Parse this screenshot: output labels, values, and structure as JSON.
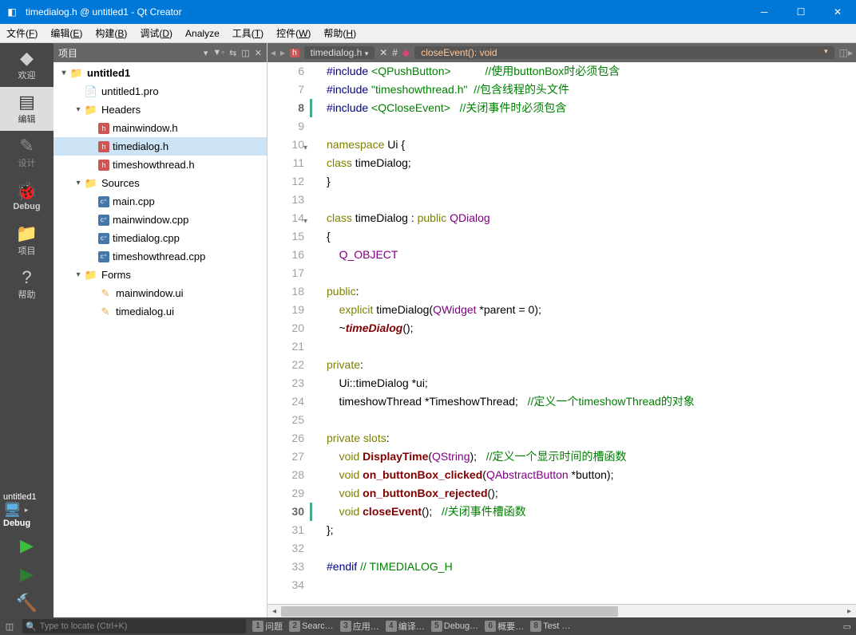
{
  "window": {
    "title": "timedialog.h @ untitled1 - Qt Creator"
  },
  "menu": {
    "items": [
      "文件(F)",
      "编辑(E)",
      "构建(B)",
      "调试(D)",
      "Analyze",
      "工具(T)",
      "控件(W)",
      "帮助(H)"
    ],
    "uline": [
      "F",
      "E",
      "B",
      "D",
      "",
      "T",
      "W",
      "H"
    ]
  },
  "modes": {
    "items": [
      {
        "label": "欢迎",
        "icon": "◆",
        "color": "green"
      },
      {
        "label": "编辑",
        "icon": "▤",
        "active": true
      },
      {
        "label": "设计",
        "icon": "✎",
        "dim": true
      },
      {
        "label": "Debug",
        "icon": "🐞",
        "bold": true
      },
      {
        "label": "项目",
        "icon": "📁"
      },
      {
        "label": "帮助",
        "icon": "?"
      }
    ]
  },
  "kit": {
    "project": "untitled1",
    "build": "Debug"
  },
  "runbuttons": [
    {
      "name": "run",
      "glyph": "▶",
      "color": "green"
    },
    {
      "name": "debug-run",
      "glyph": "▶",
      "color": "darkgreen"
    },
    {
      "name": "build",
      "glyph": "🔨",
      "color": "#c87c3a"
    }
  ],
  "sidepanel": {
    "label": "项目"
  },
  "tree": [
    {
      "d": 0,
      "tw": "▾",
      "fi": "📁",
      "cls": "orange",
      "txt": "untitled1",
      "bold": true
    },
    {
      "d": 1,
      "tw": "",
      "fi": "📄",
      "cls": "",
      "txt": "untitled1.pro"
    },
    {
      "d": 1,
      "tw": "▾",
      "fi": "📁",
      "cls": "orange",
      "txt": "Headers"
    },
    {
      "d": 2,
      "tw": "",
      "fi": "h",
      "cls": "hdr",
      "txt": "mainwindow.h"
    },
    {
      "d": 2,
      "tw": "",
      "fi": "h",
      "cls": "hdr",
      "txt": "timedialog.h",
      "sel": true
    },
    {
      "d": 2,
      "tw": "",
      "fi": "h",
      "cls": "hdr",
      "txt": "timeshowthread.h"
    },
    {
      "d": 1,
      "tw": "▾",
      "fi": "📁",
      "cls": "orange",
      "txt": "Sources"
    },
    {
      "d": 2,
      "tw": "",
      "fi": "c⁺",
      "cls": "src",
      "txt": "main.cpp"
    },
    {
      "d": 2,
      "tw": "",
      "fi": "c⁺",
      "cls": "src",
      "txt": "mainwindow.cpp"
    },
    {
      "d": 2,
      "tw": "",
      "fi": "c⁺",
      "cls": "src",
      "txt": "timedialog.cpp"
    },
    {
      "d": 2,
      "tw": "",
      "fi": "c⁺",
      "cls": "src",
      "txt": "timeshowthread.cpp"
    },
    {
      "d": 1,
      "tw": "▾",
      "fi": "📁",
      "cls": "orange",
      "txt": "Forms"
    },
    {
      "d": 2,
      "tw": "",
      "fi": "✎",
      "cls": "frm",
      "txt": "mainwindow.ui"
    },
    {
      "d": 2,
      "tw": "",
      "fi": "✎",
      "cls": "frm",
      "txt": "timedialog.ui"
    }
  ],
  "edbar": {
    "file": "timedialog.h",
    "hash": "#",
    "sym": "closeEvent(): void"
  },
  "code": {
    "start": 6,
    "current": 30,
    "folds": [
      10,
      14
    ],
    "currentExtra": 8,
    "lines": [
      [
        [
          "pp",
          "#include "
        ],
        [
          "inc",
          "<QPushButton>"
        ],
        [
          "",
          "           "
        ],
        [
          "cm",
          "//使用buttonBox时必须包含"
        ]
      ],
      [
        [
          "pp",
          "#include "
        ],
        [
          "inc",
          "\"timeshowthread.h\""
        ],
        [
          "",
          "  "
        ],
        [
          "cm",
          "//包含线程的头文件"
        ]
      ],
      [
        [
          "pp",
          "#include "
        ],
        [
          "inc",
          "<QCloseEvent>"
        ],
        [
          "",
          "   "
        ],
        [
          "cm",
          "//关闭事件时必须包含"
        ]
      ],
      [],
      [
        [
          "kw",
          "namespace"
        ],
        [
          "",
          " Ui {"
        ]
      ],
      [
        [
          "kw",
          "class"
        ],
        [
          "",
          " timeDialog;"
        ]
      ],
      [
        [
          "",
          "}"
        ]
      ],
      [],
      [
        [
          "kw",
          "class"
        ],
        [
          "",
          " timeDialog : "
        ],
        [
          "kw",
          "public"
        ],
        [
          "",
          " "
        ],
        [
          "ty",
          "QDialog"
        ]
      ],
      [
        [
          "",
          "{"
        ]
      ],
      [
        [
          "",
          "    "
        ],
        [
          "ty",
          "Q_OBJECT"
        ]
      ],
      [],
      [
        [
          "kw",
          "public"
        ],
        [
          "",
          ":"
        ]
      ],
      [
        [
          "",
          "    "
        ],
        [
          "kw",
          "explicit"
        ],
        [
          "",
          " timeDialog("
        ],
        [
          "ty",
          "QWidget"
        ],
        [
          "",
          " *parent = "
        ],
        [
          "",
          "0"
        ],
        [
          "",
          ");"
        ]
      ],
      [
        [
          "",
          "    ~"
        ],
        [
          "fnname it",
          "timeDialog"
        ],
        [
          "",
          "();"
        ]
      ],
      [],
      [
        [
          "kw",
          "private"
        ],
        [
          "",
          ":"
        ]
      ],
      [
        [
          "",
          "    Ui::timeDialog *ui;"
        ]
      ],
      [
        [
          "",
          "    timeshowThread *TimeshowThread;   "
        ],
        [
          "cm",
          "//定义一个timeshowThread的对象"
        ]
      ],
      [],
      [
        [
          "kw",
          "private"
        ],
        [
          "",
          " "
        ],
        [
          "kw",
          "slots"
        ],
        [
          "",
          ":"
        ]
      ],
      [
        [
          "",
          "    "
        ],
        [
          "kw",
          "void"
        ],
        [
          "",
          " "
        ],
        [
          "fnname",
          "DisplayTime"
        ],
        [
          "",
          "("
        ],
        [
          "ty",
          "QString"
        ],
        [
          "",
          ");   "
        ],
        [
          "cm",
          "//定义一个显示时间的槽函数"
        ]
      ],
      [
        [
          "",
          "    "
        ],
        [
          "kw",
          "void"
        ],
        [
          "",
          " "
        ],
        [
          "fnname",
          "on_buttonBox_clicked"
        ],
        [
          "",
          "("
        ],
        [
          "ty",
          "QAbstractButton"
        ],
        [
          "",
          " *button);"
        ]
      ],
      [
        [
          "",
          "    "
        ],
        [
          "kw",
          "void"
        ],
        [
          "",
          " "
        ],
        [
          "fnname",
          "on_buttonBox_rejected"
        ],
        [
          "",
          "();"
        ]
      ],
      [
        [
          "",
          "    "
        ],
        [
          "kw",
          "void"
        ],
        [
          "",
          " "
        ],
        [
          "fnname",
          "closeEvent"
        ],
        [
          "",
          "();   "
        ],
        [
          "cm",
          "//关闭事件槽函数"
        ]
      ],
      [
        [
          "",
          "};"
        ]
      ],
      [],
      [
        [
          "pp",
          "#endif "
        ],
        [
          "cm",
          "// TIMEDIALOG_H"
        ]
      ],
      []
    ]
  },
  "locator": {
    "placeholder": "Type to locate (Ctrl+K)"
  },
  "outputs": [
    {
      "n": "1",
      "l": "问题"
    },
    {
      "n": "2",
      "l": "Searc…"
    },
    {
      "n": "3",
      "l": "应用…"
    },
    {
      "n": "4",
      "l": "编译…"
    },
    {
      "n": "5",
      "l": "Debug…"
    },
    {
      "n": "6",
      "l": "概要…"
    },
    {
      "n": "8",
      "l": "Test …"
    }
  ]
}
